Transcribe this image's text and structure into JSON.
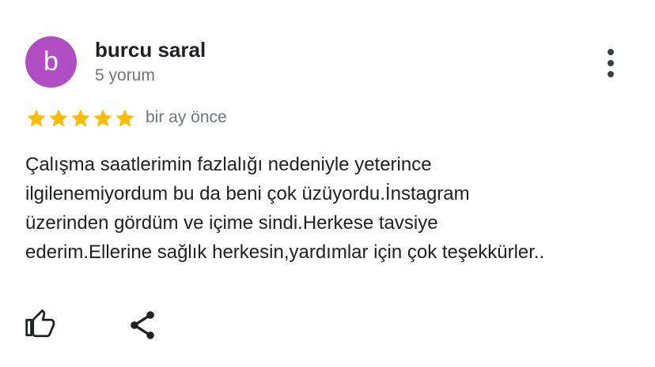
{
  "review": {
    "avatar_letter": "b",
    "avatar_color": "#b04dc2",
    "author_name": "burcu saral",
    "review_count": "5 yorum",
    "rating": 5,
    "rating_max": 5,
    "star_color": "#fbbc04",
    "time_ago": "bir ay önce",
    "text_lines": [
      "Çalışma saatlerimin fazlalığı nedeniyle yeterince",
      "ilgilenemiyordum bu da beni çok üzüyordu.İnstagram",
      "üzerinden gördüm ve içime sindi.Herkese tavsiye",
      "ederim.Ellerine sağlık herkesin,yardımlar için çok teşekkürler.."
    ]
  },
  "actions": {
    "menu_icon": "more-vert-icon",
    "like_icon": "thumb-up-icon",
    "share_icon": "share-icon"
  }
}
